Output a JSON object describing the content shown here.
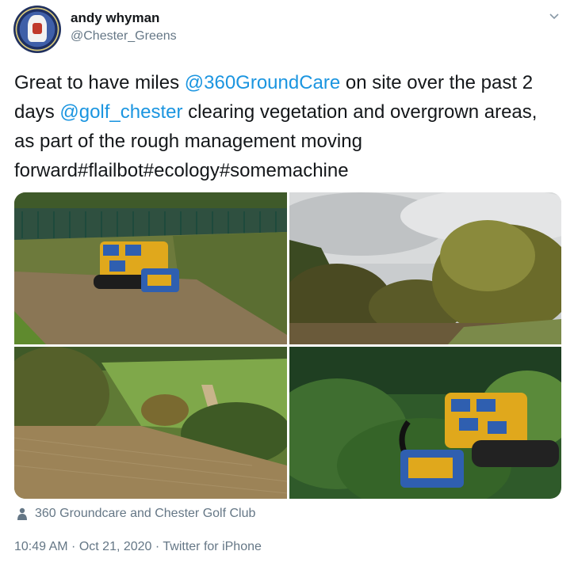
{
  "author": {
    "name": "andy whyman",
    "handle": "@Chester_Greens",
    "avatar_icon": "club-crest-avatar"
  },
  "tweet": {
    "segments": [
      {
        "text": "Great to have miles ",
        "type": "text"
      },
      {
        "text": "@360GroundCare",
        "type": "mention"
      },
      {
        "text": " on site over the past 2 days ",
        "type": "text"
      },
      {
        "text": "@golf_chester",
        "type": "mention"
      },
      {
        "text": " clearing vegetation and overgrown areas, as part of the rough management moving forward#flailbot#ecology#somemachine",
        "type": "text"
      }
    ]
  },
  "media": {
    "count": 4,
    "alt": [
      "robotic flail mower on embankment",
      "trees and bushes under cloudy sky",
      "cleared slope beside fairway",
      "robotic flail mower in undergrowth"
    ]
  },
  "location": {
    "icon": "person-icon",
    "label": "360 Groundcare and Chester Golf Club"
  },
  "meta": {
    "time": "10:49 AM",
    "date": "Oct 21, 2020",
    "source": "Twitter for iPhone",
    "separator": " · "
  },
  "colors": {
    "link": "#1b95e0",
    "secondary_text": "#657786",
    "primary_text": "#14171a"
  }
}
